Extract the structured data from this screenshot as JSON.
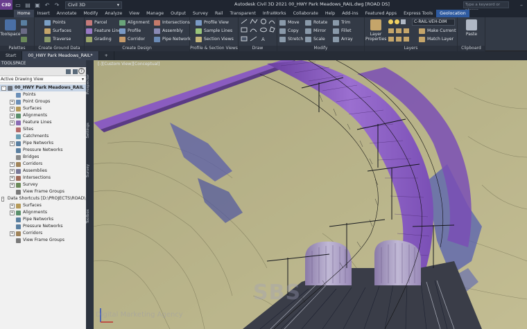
{
  "titlebar": {
    "app_badge": "C3D",
    "workspace": "Civil 3D",
    "window_title": "Autodesk Civil 3D 2021    00_HWY Park Meadows_RAIL.dwg [ROAD DS]",
    "search_placeholder": "Type a keyword or phrase"
  },
  "ribbon_tabs": [
    "Home",
    "Insert",
    "Annotate",
    "Modify",
    "Analyze",
    "View",
    "Manage",
    "Output",
    "Survey",
    "Rail",
    "Transparent",
    "InfraWorks",
    "Collaborate",
    "Help",
    "Add-ins",
    "Featured Apps",
    "Express Tools",
    "Geolocation"
  ],
  "ribbon": {
    "palettes": {
      "title": "Palettes",
      "toolspace": "Toolspace"
    },
    "ground_data": {
      "title": "Create Ground Data",
      "points": "Points",
      "surfaces": "Surfaces",
      "traverse": "Traverse"
    },
    "create_design": {
      "title": "Create Design",
      "parcel": "Parcel",
      "feature_line": "Feature Line",
      "grading": "Grading",
      "alignment": "Alignment",
      "profile": "Profile",
      "corridor": "Corridor",
      "intersections": "Intersections",
      "assembly": "Assembly",
      "pipe_network": "Pipe Network"
    },
    "profile_section": {
      "title": "Profile & Section Views",
      "profile_view": "Profile View",
      "sample_lines": "Sample Lines",
      "section_views": "Section Views"
    },
    "draw": {
      "title": "Draw"
    },
    "modify": {
      "title": "Modify",
      "move": "Move",
      "rotate": "Rotate",
      "trim": "Trim",
      "copy": "Copy",
      "mirror": "Mirror",
      "fillet": "Fillet",
      "stretch": "Stretch",
      "scale": "Scale",
      "array": "Array"
    },
    "layers": {
      "title": "Layers",
      "layer_properties": "Layer Properties",
      "current_layer": "C-RAIL-VEH-DIM",
      "make_current": "Make Current",
      "match_layer": "Match Layer"
    },
    "clipboard": {
      "title": "Clipboard",
      "paste": "Paste"
    }
  },
  "filetabs": [
    "Start",
    "00_HWY Park Meadows_RAIL*",
    "+"
  ],
  "toolspace": {
    "header": "TOOLSPACE",
    "view": "Active Drawing View",
    "items": [
      {
        "label": "00_HWY Park Meadows_RAIL",
        "level": 0,
        "exp": "-",
        "color": "#6a6f78"
      },
      {
        "label": "Points",
        "level": 1,
        "exp": "",
        "color": "#6b8fb8"
      },
      {
        "label": "Point Groups",
        "level": 1,
        "exp": "+",
        "color": "#6b8fb8"
      },
      {
        "label": "Surfaces",
        "level": 1,
        "exp": "+",
        "color": "#b59a5a"
      },
      {
        "label": "Alignments",
        "level": 1,
        "exp": "+",
        "color": "#5a8f6b"
      },
      {
        "label": "Feature Lines",
        "level": 1,
        "exp": "+",
        "color": "#8a6bb5"
      },
      {
        "label": "Sites",
        "level": 1,
        "exp": "",
        "color": "#b56b6b"
      },
      {
        "label": "Catchments",
        "level": 1,
        "exp": "",
        "color": "#6b9fb5"
      },
      {
        "label": "Pipe Networks",
        "level": 1,
        "exp": "+",
        "color": "#5a7fa0"
      },
      {
        "label": "Pressure Networks",
        "level": 1,
        "exp": "",
        "color": "#5a7fa0"
      },
      {
        "label": "Bridges",
        "level": 1,
        "exp": "",
        "color": "#8a8a8a"
      },
      {
        "label": "Corridors",
        "level": 1,
        "exp": "+",
        "color": "#a0845a"
      },
      {
        "label": "Assemblies",
        "level": 1,
        "exp": "+",
        "color": "#7a7a9a"
      },
      {
        "label": "Intersections",
        "level": 1,
        "exp": "+",
        "color": "#a06b5a"
      },
      {
        "label": "Survey",
        "level": 1,
        "exp": "+",
        "color": "#6b8a5a"
      },
      {
        "label": "View Frame Groups",
        "level": 1,
        "exp": "",
        "color": "#7a7a7a"
      },
      {
        "label": "Data Shortcuts [D:\\PROJECTS\\ROAD\\...",
        "level": 0,
        "exp": "-",
        "color": "#5a7fa0"
      },
      {
        "label": "Surfaces",
        "level": 1,
        "exp": "+",
        "color": "#b59a5a"
      },
      {
        "label": "Alignments",
        "level": 1,
        "exp": "+",
        "color": "#5a8f6b"
      },
      {
        "label": "Pipe Networks",
        "level": 1,
        "exp": "",
        "color": "#5a7fa0"
      },
      {
        "label": "Pressure Networks",
        "level": 1,
        "exp": "",
        "color": "#5a7fa0"
      },
      {
        "label": "Corridors",
        "level": 1,
        "exp": "+",
        "color": "#a0845a"
      },
      {
        "label": "View Frame Groups",
        "level": 1,
        "exp": "",
        "color": "#7a7a7a"
      }
    ]
  },
  "sidetabs": [
    "Prospector",
    "Settings",
    "Survey",
    "Toolbox"
  ],
  "viewport": {
    "label": "[-][Custom View][Conceptual]",
    "watermark": "SBS",
    "watermark_tagline": "Digital Marketing Agency"
  },
  "colors": {
    "terrain": "#b8b38a",
    "tunnel": "#8a5cc0",
    "accent": "#2e5aa0"
  }
}
